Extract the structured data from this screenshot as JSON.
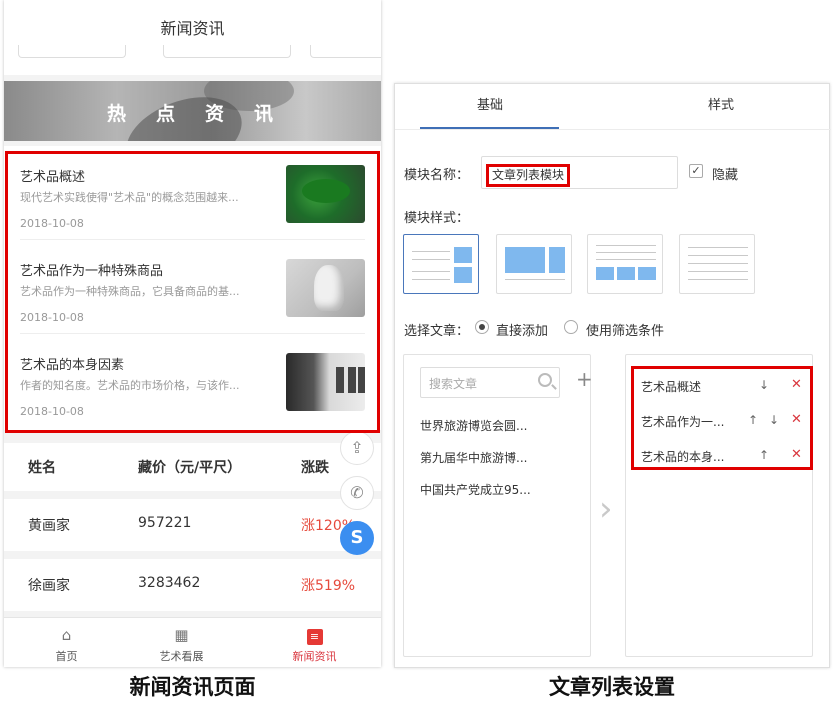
{
  "phone": {
    "title": "新闻资讯",
    "banner_title": "热点资讯",
    "news": [
      {
        "title": "艺术品概述",
        "desc": "现代艺术实践使得\"艺术品\"的概念范围越来...",
        "date": "2018-10-08"
      },
      {
        "title": "艺术品作为一种特殊商品",
        "desc": "艺术品作为一种特殊商品，它具备商品的基...",
        "date": "2018-10-08"
      },
      {
        "title": "艺术品的本身因素",
        "desc": "作者的知名度。艺术品的市场价格，与该作...",
        "date": "2018-10-08"
      }
    ],
    "table": {
      "headers": [
        "姓名",
        "藏价（元/平尺）",
        "涨跌"
      ],
      "rows": [
        [
          "黄画家",
          "957221",
          "涨120%"
        ],
        [
          "徐画家",
          "3283462",
          "涨519%"
        ]
      ]
    },
    "tabbar": [
      {
        "label": "首页",
        "icon": "home-icon"
      },
      {
        "label": "艺术看展",
        "icon": "grid-icon"
      },
      {
        "label": "新闻资讯",
        "icon": "news-icon"
      }
    ],
    "accent": "#d9363e"
  },
  "settings": {
    "tabs": [
      "基础",
      "样式"
    ],
    "module_name_label": "模块名称：",
    "module_name_value": "文章列表模块",
    "hide_label": "隐藏",
    "module_style_label": "模块样式：",
    "select_label": "选择文章：",
    "radio_direct": "直接添加",
    "radio_filter": "使用筛选条件",
    "search_placeholder": "搜索文章",
    "articles": [
      "世界旅游博览会圆...",
      "第九届华中旅游博...",
      "中国共产党成立95..."
    ],
    "selected": [
      "艺术品概述",
      "艺术品作为一...",
      "艺术品的本身..."
    ]
  },
  "captions": {
    "left": "新闻资讯页面",
    "right": "文章列表设置"
  }
}
